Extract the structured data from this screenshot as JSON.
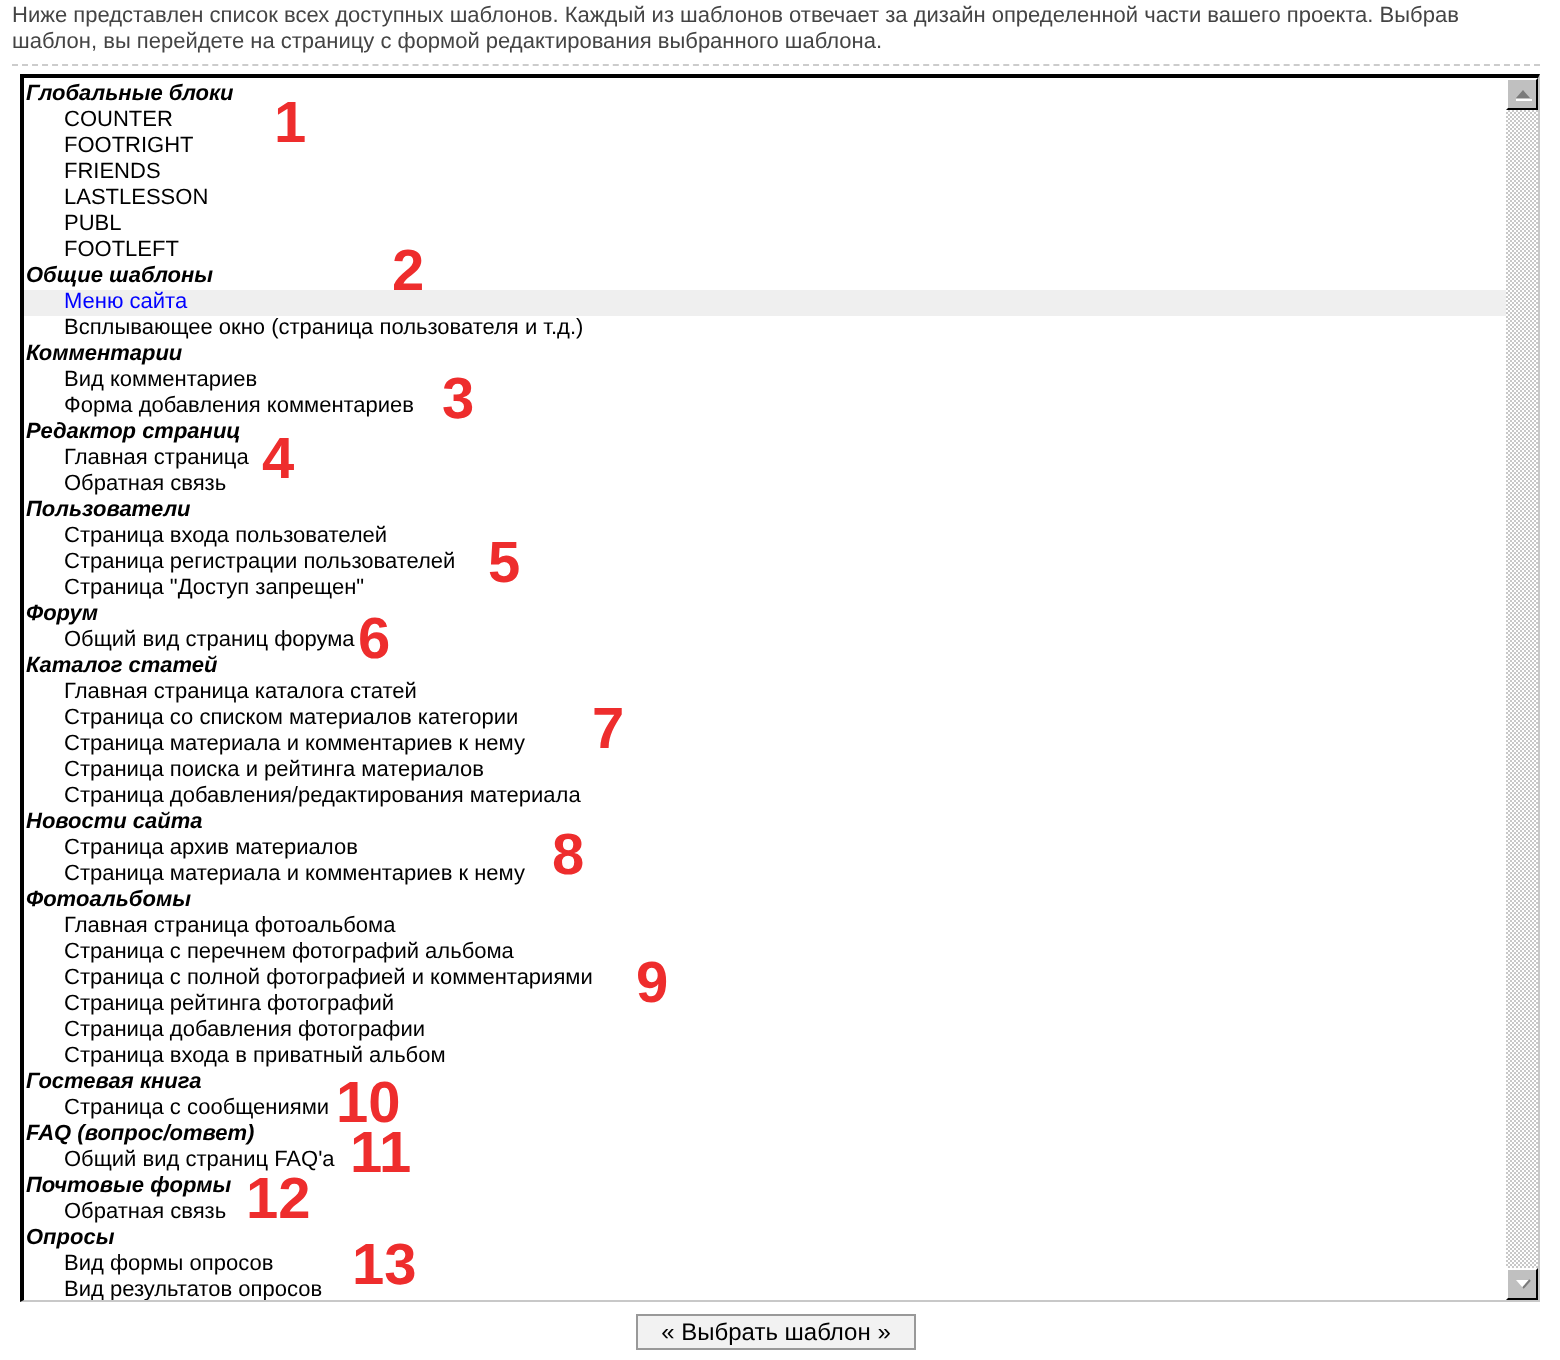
{
  "intro": "Ниже представлен список всех доступных шаблонов. Каждый из шаблонов отвечает за дизайн определенной части вашего проекта. Выбрав шаблон, вы перейдете на страницу с формой редактирования выбранного шаблона.",
  "groups": [
    {
      "title": "Глобальные блоки",
      "annotation": "1",
      "items": [
        {
          "label": "COUNTER",
          "selected": false
        },
        {
          "label": "FOOTRIGHT",
          "selected": false
        },
        {
          "label": "FRIENDS",
          "selected": false
        },
        {
          "label": "LASTLESSON",
          "selected": false
        },
        {
          "label": "PUBL",
          "selected": false
        },
        {
          "label": "FOOTLEFT",
          "selected": false
        }
      ]
    },
    {
      "title": "Общие шаблоны",
      "annotation": "2",
      "items": [
        {
          "label": "Меню сайта",
          "selected": true
        },
        {
          "label": "Всплывающее окно (страница пользователя и т.д.)",
          "selected": false
        }
      ]
    },
    {
      "title": "Комментарии",
      "annotation": "3",
      "items": [
        {
          "label": "Вид комментариев",
          "selected": false
        },
        {
          "label": "Форма добавления комментариев",
          "selected": false
        }
      ]
    },
    {
      "title": "Редактор страниц",
      "annotation": "4",
      "items": [
        {
          "label": "Главная страница",
          "selected": false
        },
        {
          "label": "Обратная связь",
          "selected": false
        }
      ]
    },
    {
      "title": "Пользователи",
      "annotation": "5",
      "items": [
        {
          "label": "Страница входа пользователей",
          "selected": false
        },
        {
          "label": "Страница регистрации пользователей",
          "selected": false
        },
        {
          "label": "Страница \"Доступ запрещен\"",
          "selected": false
        }
      ]
    },
    {
      "title": "Форум",
      "annotation": "6",
      "items": [
        {
          "label": "Общий вид страниц форума",
          "selected": false
        }
      ]
    },
    {
      "title": "Каталог статей",
      "annotation": "7",
      "items": [
        {
          "label": "Главная страница каталога статей",
          "selected": false
        },
        {
          "label": "Страница со списком материалов категории",
          "selected": false
        },
        {
          "label": "Страница материала и комментариев к нему",
          "selected": false
        },
        {
          "label": "Страница поиска и рейтинга материалов",
          "selected": false
        },
        {
          "label": "Страница добавления/редактирования материала",
          "selected": false
        }
      ]
    },
    {
      "title": "Новости сайта",
      "annotation": "8",
      "items": [
        {
          "label": "Страница архив материалов",
          "selected": false
        },
        {
          "label": "Страница материала и комментариев к нему",
          "selected": false
        }
      ]
    },
    {
      "title": "Фотоальбомы",
      "annotation": "9",
      "items": [
        {
          "label": "Главная страница фотоальбома",
          "selected": false
        },
        {
          "label": "Страница с перечнем фотографий альбома",
          "selected": false
        },
        {
          "label": "Страница с полной фотографией и комментариями",
          "selected": false
        },
        {
          "label": "Страница рейтинга фотографий",
          "selected": false
        },
        {
          "label": "Страница добавления фотографии",
          "selected": false
        },
        {
          "label": "Страница входа в приватный альбом",
          "selected": false
        }
      ]
    },
    {
      "title": "Гостевая книга",
      "annotation": "10",
      "items": [
        {
          "label": "Страница с сообщениями",
          "selected": false
        }
      ]
    },
    {
      "title": "FAQ (вопрос/ответ)",
      "annotation": "11",
      "items": [
        {
          "label": "Общий вид страниц FAQ'а",
          "selected": false
        }
      ]
    },
    {
      "title": "Почтовые формы",
      "annotation": "12",
      "items": [
        {
          "label": "Обратная связь",
          "selected": false
        }
      ]
    },
    {
      "title": "Опросы",
      "annotation": "13",
      "items": [
        {
          "label": "Вид формы опросов",
          "selected": false
        },
        {
          "label": "Вид результатов опросов",
          "selected": false
        }
      ]
    }
  ],
  "button": "« Выбрать шаблон »"
}
